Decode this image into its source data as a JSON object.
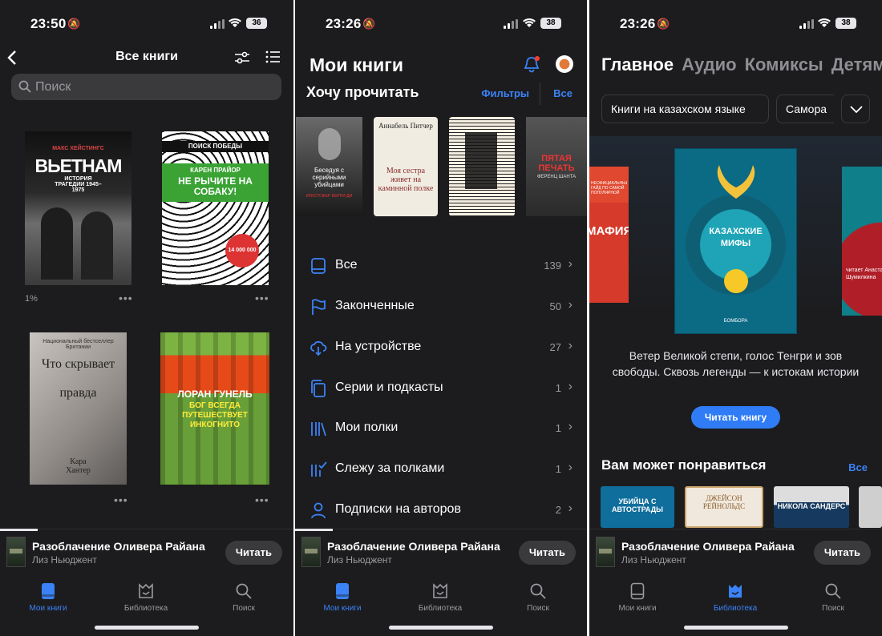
{
  "colors": {
    "background": "#1c1c1e",
    "accent": "#3b82f6",
    "muted": "#9a9aa0",
    "button": "#2f7cf6"
  },
  "status_bars": [
    {
      "time": "23:50",
      "battery": "36"
    },
    {
      "time": "23:26",
      "battery": "38"
    },
    {
      "time": "23:26",
      "battery": "38"
    }
  ],
  "panel1": {
    "title": "Все книги",
    "search_placeholder": "Поиск",
    "books": [
      {
        "title": "ВЬЕТНАМ",
        "author": "МАКС ХЕЙСТИНГС",
        "subtitle": "ИСТОРИЯ ТРАГЕДИИ 1945–1975",
        "progress": "1%"
      },
      {
        "title": "НЕ РЫЧИТЕ НА СОБАКУ!",
        "author": "КАРЕН ПРАЙОР",
        "publisher": "ПОИСК ПОБЕДЫ",
        "badge": "14 000 000"
      },
      {
        "title": "Что скрывает правда",
        "author": "Кара Хантер",
        "blurb": "Национальный бестселлер Британии"
      },
      {
        "title": "БОГ ВСЕГДА ПУТЕШЕСТВУЕТ ИНКОГНИТО",
        "author": "ЛОРАН ГУНЕЛЬ"
      }
    ]
  },
  "panel2": {
    "title": "Мои книги",
    "section_title": "Хочу прочитать",
    "filters_label": "Фильтры",
    "all_label": "Все",
    "shelf_books": [
      {
        "title": "Беседуя с серийными убийцами",
        "author": "КРИСТОФЕР БЕРРИ-ДИ"
      },
      {
        "title": "Моя сестра живет на каминной полке",
        "author": "Аннабель Питчер"
      },
      {
        "title": ""
      },
      {
        "title": "ПЯТАЯ ПЕЧАТЬ",
        "author": "ФЕРЕНЦ ШАНТА"
      }
    ],
    "list": [
      {
        "label": "Все",
        "count": "139",
        "icon": "book-icon"
      },
      {
        "label": "Законченные",
        "count": "50",
        "icon": "flag-icon"
      },
      {
        "label": "На устройстве",
        "count": "27",
        "icon": "cloud-download-icon"
      },
      {
        "label": "Серии и подкасты",
        "count": "1",
        "icon": "series-icon"
      },
      {
        "label": "Мои полки",
        "count": "1",
        "icon": "shelves-icon"
      },
      {
        "label": "Слежу за полками",
        "count": "1",
        "icon": "shelf-follow-icon"
      },
      {
        "label": "Подписки на авторов",
        "count": "2",
        "icon": "person-icon"
      }
    ]
  },
  "panel3": {
    "tabs": [
      "Главное",
      "Аудио",
      "Комиксы",
      "Детям"
    ],
    "chips": [
      "Книги на казахском языке",
      "Самора"
    ],
    "featured": {
      "title": "КАЗАХСКИЕ МИФЫ",
      "publisher": "БОМБОРА"
    },
    "side_left": {
      "text": "МАФИЯ",
      "note": "НЕОФИЦИАЛЬНЫЙ ГАЙД ПО САМОЙ ПОПУЛЯРНОЙ СЕРИАЛУ ГОДА"
    },
    "side_right": {
      "text": "читает Анастасия Шумилкина"
    },
    "description": "Ветер Великой степи, голос Тенгри и зов свободы. Сквозь легенды — к истокам истории",
    "cta": "Читать книгу",
    "rec_title": "Вам может понравиться",
    "rec_all": "Все",
    "rec_books": [
      {
        "title": "УБИЙЦА С АВТОСТРАДЫ"
      },
      {
        "title": "ДЖЕЙСОН РЕЙНОЛЬДС"
      },
      {
        "title": "НИКОЛА САНДЕРС"
      },
      {
        "title": ""
      }
    ]
  },
  "mini_player": {
    "title": "Разоблачение Оливера Райана",
    "author": "Лиз Ньюджент",
    "button": "Читать"
  },
  "tabbar": {
    "my_books": "Мои книги",
    "library": "Библиотека",
    "search": "Поиск"
  }
}
